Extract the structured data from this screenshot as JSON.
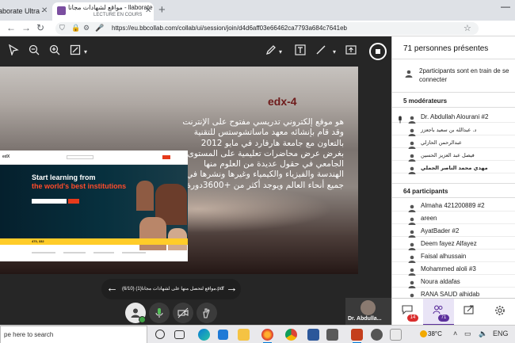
{
  "browser": {
    "tab1_title": "llaborate Ultra -",
    "tab2_title": "مواقع لشهادات مجانا - llaborate",
    "tab2_subtitle": "LECTURE EN COURS",
    "url": "https://eu.bbcollab.com/collab/ui/session/join/d4d6aff03e66462ca7793a684c7641eb"
  },
  "slide": {
    "title": "edx-4",
    "body": "هو موقع إلكتروني تدريسي مفتوح على الإنترنت وقد قام بإنشائه معهد ماساتشوستس للتقنية بالتعاون مع جامعة هارفارد في مايو 2012 بغرض عرض محاضرات تعليمية على المستوى الجامعي في حقول عديدة من العلوم منها الهندسة والفيزياء والكيمياء وغيرها ونشرها في جميع أنحاء العالم ويوجد أكثر من +3600دورة.",
    "screenshot": {
      "headline1": "Start learning from",
      "headline2": "the world's best institutions",
      "stat": "470, 332"
    }
  },
  "pager": {
    "label": "(6/10)  مواقع لتحصل منها على لشهادات مجانا(1).pdf"
  },
  "speaker": {
    "name": "Dr. Abdulla..."
  },
  "panel": {
    "title": "71 personnes présentes",
    "joining": "2participants sont en train de se connecter",
    "moderators_header": "5 modérateurs",
    "moderators": [
      "Dr. Abdullah Alourani #2",
      "د. عبدالله بن سعيد باجعزز",
      "عبدالرحمن الحازلي",
      "فيصل عبد العزيز الحسين",
      "مهدي محمد الناصر الجملي"
    ],
    "participants_header": "64 participants",
    "participants": [
      "Almaha 421200889 #2",
      "areen",
      "AyatBader #2",
      "Deem fayez Alfayez",
      "Faisal alhussain",
      "Mohammed aloli #3",
      "Noura aldafas",
      "RANA SAUD alhidab"
    ],
    "badges": {
      "chat": "14",
      "attendees": "71"
    }
  },
  "taskbar": {
    "search_placeholder": "pe here to search",
    "temperature": "38°C"
  },
  "colors": {
    "accent": "#5b2f9c",
    "chat_badge": "#d92d2d",
    "slide_title": "#6e1a1a"
  }
}
